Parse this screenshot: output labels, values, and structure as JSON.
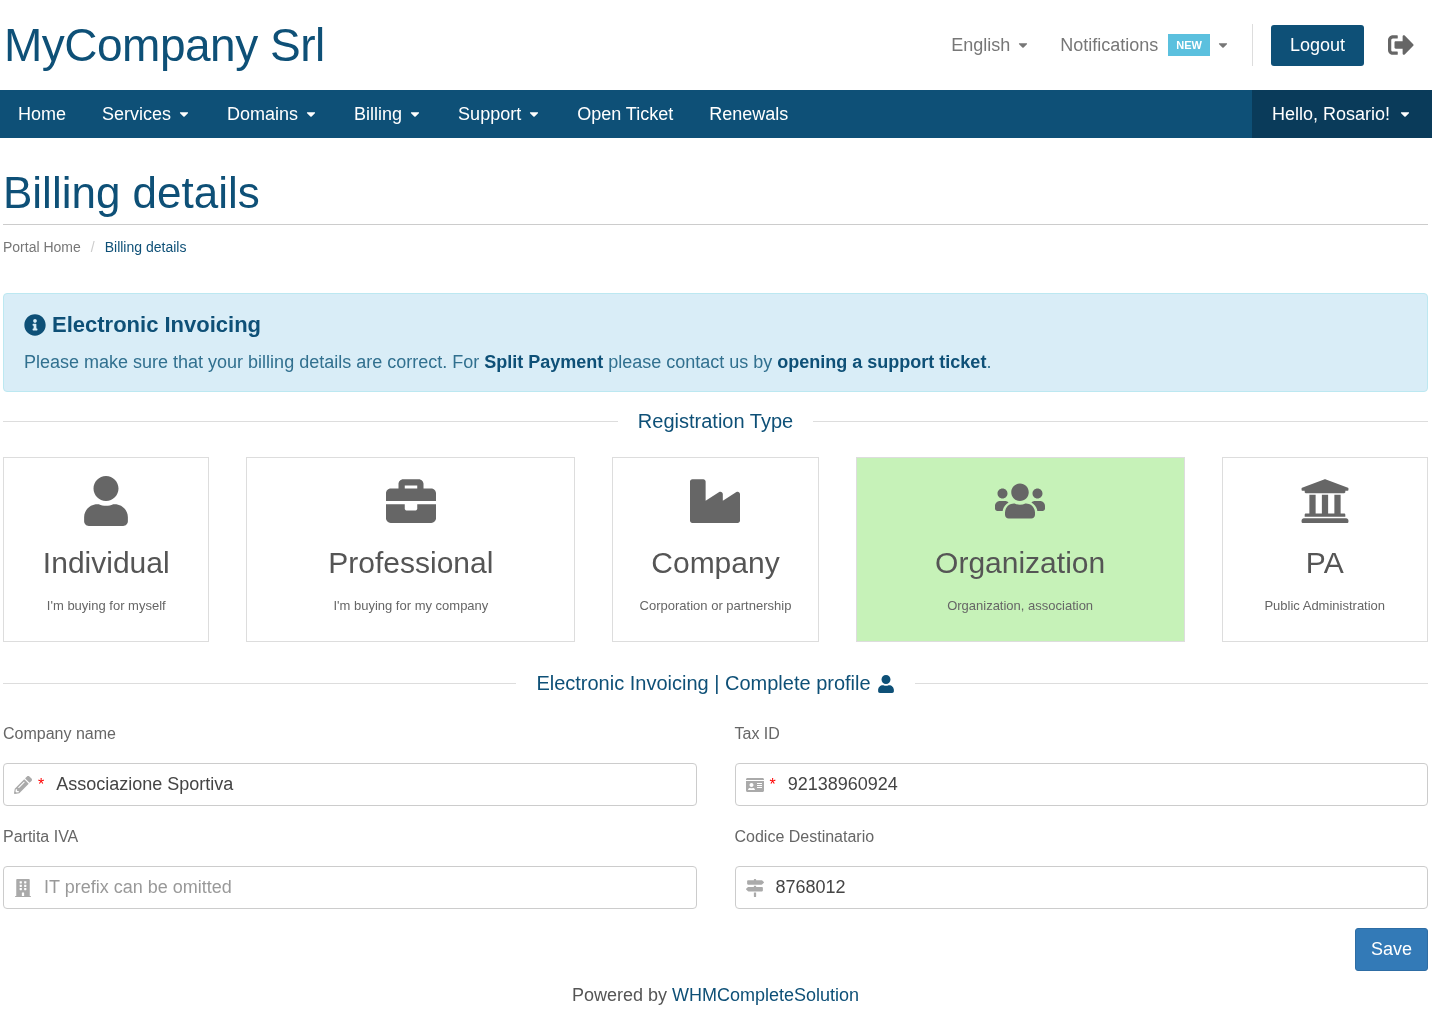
{
  "header": {
    "logo": "MyCompany Srl",
    "language": "English",
    "notifications": {
      "label": "Notifications",
      "badge": "NEW"
    },
    "logout": "Logout"
  },
  "nav": {
    "items": [
      {
        "label": "Home",
        "dropdown": false
      },
      {
        "label": "Services",
        "dropdown": true
      },
      {
        "label": "Domains",
        "dropdown": true
      },
      {
        "label": "Billing",
        "dropdown": true
      },
      {
        "label": "Support",
        "dropdown": true
      },
      {
        "label": "Open Ticket",
        "dropdown": false
      },
      {
        "label": "Renewals",
        "dropdown": false
      }
    ],
    "user": "Hello, Rosario!"
  },
  "page_title": "Billing details",
  "breadcrumb": {
    "separator": "/",
    "items": [
      {
        "label": "Portal Home",
        "selected": false
      },
      {
        "label": "Billing details",
        "selected": true
      }
    ]
  },
  "alert": {
    "title": "Electronic Invoicing",
    "text": "Please make sure that your billing details are correct. For **Split Payment** please contact us by ",
    "link": "opening a support ticket",
    "text_after": "."
  },
  "registration_type": {
    "heading": "Registration Type",
    "options": [
      {
        "kind": "individual",
        "title": "Individual",
        "subtitle": "I'm buying for myself",
        "selected": false
      },
      {
        "kind": "professional",
        "title": "Professional",
        "subtitle": "I'm buying for my company",
        "selected": false
      },
      {
        "kind": "company",
        "title": "Company",
        "subtitle": "Corporation or partnership",
        "selected": false
      },
      {
        "kind": "organization",
        "title": "Organization",
        "subtitle": "Organization, association",
        "selected": true
      },
      {
        "kind": "pa",
        "title": "PA",
        "subtitle": "Public Administration",
        "selected": false
      }
    ]
  },
  "profile_heading": "Electronic Invoicing | Complete profile",
  "fields": [
    {
      "kind": "name",
      "label": "Company name",
      "marker": "*",
      "value": "Associazione Sportiva"
    },
    {
      "kind": "tax",
      "label": "Tax ID",
      "marker": "*",
      "value": "92138960924"
    },
    {
      "kind": "vat",
      "label": "Partita IVA",
      "placeholder": "IT prefix can be omitted"
    },
    {
      "kind": "code",
      "label": "Codice Destinatario",
      "value": "8768012"
    }
  ],
  "save": "Save",
  "footer": {
    "text": "Powered by ",
    "link": "WHMCompleteSolution"
  }
}
